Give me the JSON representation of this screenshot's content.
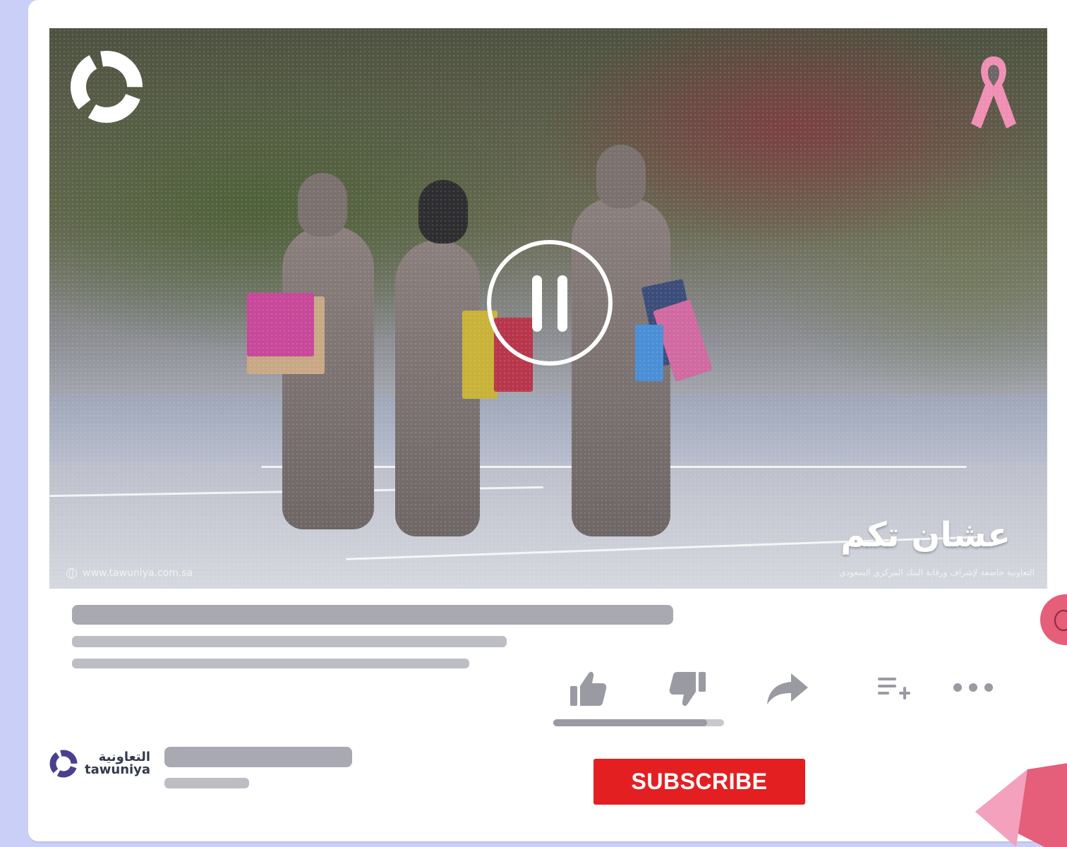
{
  "video": {
    "overlay_title": "عشان تكم",
    "disclaimer": "التعاونية خاضعة لإشراف ورقابة البنك المركزي السعودي",
    "website": "www.tawuniya.com.sa",
    "state": "paused-button-visible"
  },
  "actions": {
    "like_icon": "thumbs-up-icon",
    "dislike_icon": "thumbs-down-icon",
    "share_icon": "share-arrow-icon",
    "playlist_icon": "add-to-playlist-icon",
    "more_icon": "more-horizontal-icon",
    "like_ratio": 0.9
  },
  "channel": {
    "name_ar": "التعاونية",
    "name_en": "tawuniya"
  },
  "subscribe": {
    "label": "SUBSCRIBE"
  },
  "colors": {
    "background": "#c9cff7",
    "subscribe": "#e41f22",
    "skeleton": "#a9a9b2",
    "icon": "#9a9aa2",
    "ribbon": "#f08fb4",
    "accent_pink": "#e55e7a"
  }
}
